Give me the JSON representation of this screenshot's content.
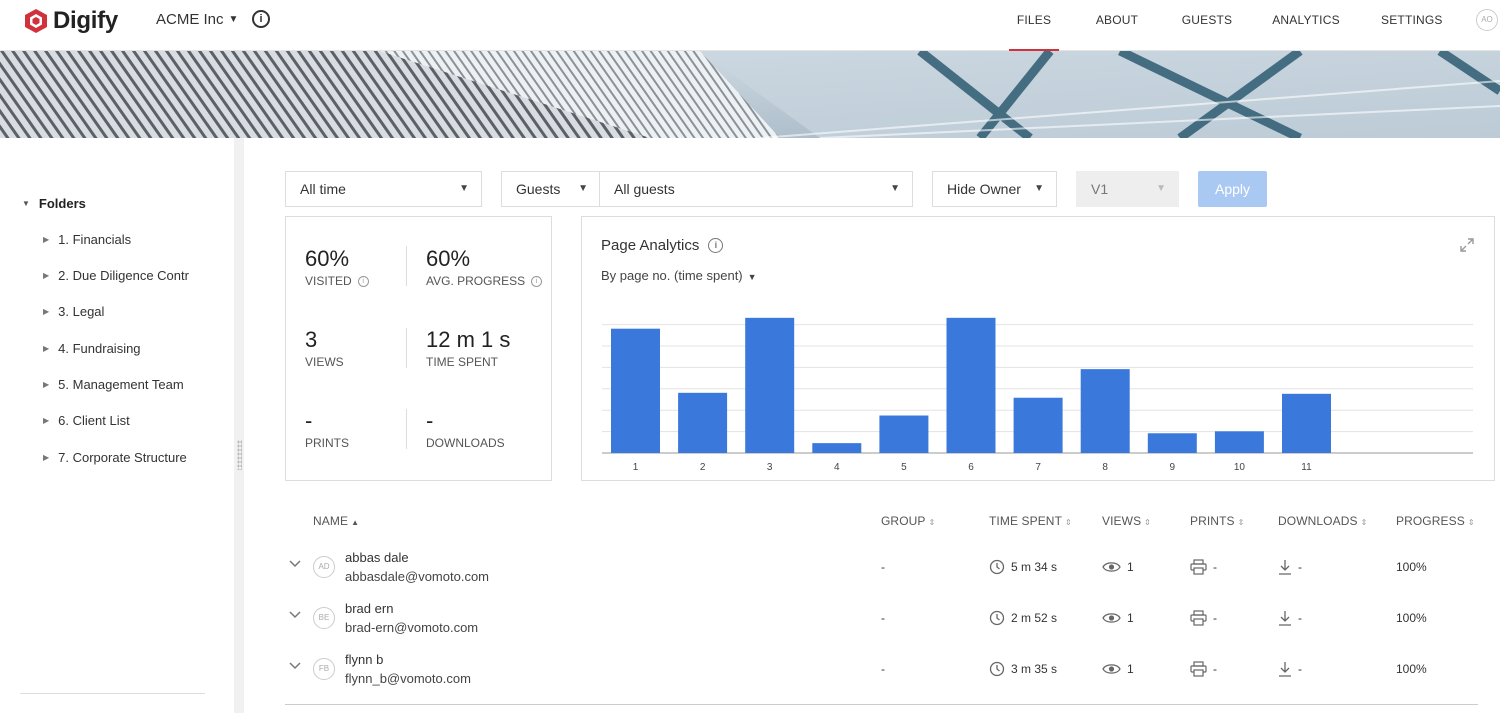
{
  "app": {
    "logo_text": "Digify",
    "org_name": "ACME Inc",
    "user_initials": "AO"
  },
  "nav": {
    "files": "FILES",
    "about": "ABOUT",
    "guests": "GUESTS",
    "analytics": "ANALYTICS",
    "settings": "SETTINGS"
  },
  "sidebar": {
    "heading": "Folders",
    "items": [
      "1. Financials",
      "2. Due Diligence Contr",
      "3. Legal",
      "4. Fundraising",
      "5. Management Team",
      "6. Client List",
      "7. Corporate Structure"
    ]
  },
  "filters": {
    "time": "All time",
    "type": "Guests",
    "who": "All guests",
    "owner": "Hide Owner",
    "version": "V1",
    "apply": "Apply"
  },
  "stats": {
    "visited_value": "60%",
    "visited_label": "VISITED",
    "progress_value": "60%",
    "progress_label": "AVG. PROGRESS",
    "views_value": "3",
    "views_label": "VIEWS",
    "time_value": "12 m 1 s",
    "time_label": "TIME SPENT",
    "prints_value": "-",
    "prints_label": "PRINTS",
    "downloads_value": "-",
    "downloads_label": "DOWNLOADS"
  },
  "chart_panel": {
    "title": "Page Analytics",
    "subtitle": "By page no. (time spent)"
  },
  "chart_data": {
    "type": "bar",
    "categories": [
      "1",
      "2",
      "3",
      "4",
      "5",
      "6",
      "7",
      "8",
      "9",
      "10",
      "11"
    ],
    "values": [
      126,
      61,
      137,
      10,
      38,
      137,
      56,
      85,
      20,
      22,
      60
    ],
    "ylim": [
      0,
      150
    ],
    "grid": true,
    "color": "#3b78db"
  },
  "table": {
    "headers": {
      "name": "NAME",
      "group": "GROUP",
      "time": "TIME SPENT",
      "views": "VIEWS",
      "prints": "PRINTS",
      "downloads": "DOWNLOADS",
      "progress": "PROGRESS"
    },
    "rows": [
      {
        "initials": "AD",
        "name": "abbas dale",
        "email": "abbasdale@vomoto.com",
        "group": "-",
        "time": "5 m 34 s",
        "views": "1",
        "prints": "-",
        "downloads": "-",
        "progress": "100%"
      },
      {
        "initials": "BE",
        "name": "brad ern",
        "email": "brad-ern@vomoto.com",
        "group": "-",
        "time": "2 m 52 s",
        "views": "1",
        "prints": "-",
        "downloads": "-",
        "progress": "100%"
      },
      {
        "initials": "FB",
        "name": "flynn b",
        "email": "flynn_b@vomoto.com",
        "group": "-",
        "time": "3 m 35 s",
        "views": "1",
        "prints": "-",
        "downloads": "-",
        "progress": "100%"
      }
    ]
  },
  "icons": {
    "brand": "hexagon-logo-icon",
    "accent": "#d0313b"
  }
}
